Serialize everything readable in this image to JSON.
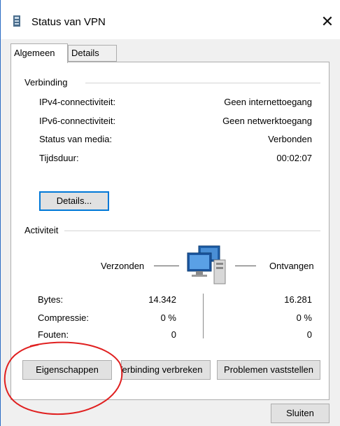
{
  "window": {
    "title": "Status van VPN",
    "close_glyph": "✕"
  },
  "tabs": [
    {
      "label": "Algemeen"
    },
    {
      "label": "Details"
    }
  ],
  "connection": {
    "group_label": "Verbinding",
    "rows": [
      {
        "label": "IPv4-connectiviteit:",
        "value": "Geen internettoegang"
      },
      {
        "label": "IPv6-connectiviteit:",
        "value": "Geen netwerktoegang"
      },
      {
        "label": "Status van media:",
        "value": "Verbonden"
      },
      {
        "label": "Tijdsduur:",
        "value": "00:02:07"
      }
    ],
    "details_button": "Details..."
  },
  "activity": {
    "group_label": "Activiteit",
    "sent_label": "Verzonden",
    "received_label": "Ontvangen",
    "rows": [
      {
        "label": "Bytes:",
        "sent": "14.342",
        "received": "16.281"
      },
      {
        "label": "Compressie:",
        "sent": "0 %",
        "received": "0 %"
      },
      {
        "label": "Fouten:",
        "sent": "0",
        "received": "0"
      }
    ]
  },
  "buttons": {
    "properties": "Eigenschappen",
    "disconnect": "Verbinding verbreken",
    "diagnose": "Problemen vaststellen",
    "close": "Sluiten"
  },
  "annotation": {
    "color": "#e02020"
  },
  "colors": {
    "accent": "#0078d7",
    "window_border": "#2b6cc4"
  }
}
